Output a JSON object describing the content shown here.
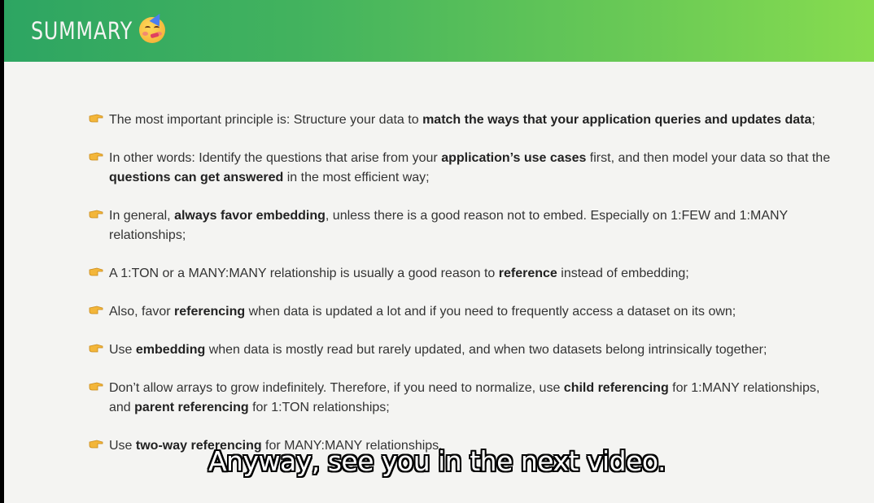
{
  "header": {
    "title": "SUMMARY",
    "emoji": "partying-face-icon",
    "gradient": [
      "#2da562",
      "#87dc4f"
    ]
  },
  "bullet_icon": "pointing-hand-icon",
  "items": [
    {
      "parts": [
        {
          "t": "The most important principle is: Structure your data to ",
          "b": false
        },
        {
          "t": "match the ways that your application queries and updates data",
          "b": true
        },
        {
          "t": ";",
          "b": false
        }
      ]
    },
    {
      "parts": [
        {
          "t": "In other words: Identify the questions that arise from your ",
          "b": false
        },
        {
          "t": "application’s use cases",
          "b": true
        },
        {
          "t": " first, and then model your data so that the ",
          "b": false
        },
        {
          "t": "questions can get answered",
          "b": true
        },
        {
          "t": " in the most efficient way;",
          "b": false
        }
      ]
    },
    {
      "parts": [
        {
          "t": "In general, ",
          "b": false
        },
        {
          "t": "always favor embedding",
          "b": true
        },
        {
          "t": ", unless there is a good reason not to embed. Especially on 1:FEW and 1:MANY relationships;",
          "b": false
        }
      ]
    },
    {
      "parts": [
        {
          "t": "A 1:TON or a MANY:MANY relationship is usually a good reason to ",
          "b": false
        },
        {
          "t": "reference",
          "b": true
        },
        {
          "t": " instead of embedding;",
          "b": false
        }
      ]
    },
    {
      "parts": [
        {
          "t": "Also, favor ",
          "b": false
        },
        {
          "t": "referencing",
          "b": true
        },
        {
          "t": " when data is updated a lot and if you need to frequently access a dataset on its own;",
          "b": false
        }
      ]
    },
    {
      "parts": [
        {
          "t": "Use ",
          "b": false
        },
        {
          "t": "embedding",
          "b": true
        },
        {
          "t": " when data is mostly read but rarely updated, and when two datasets belong intrinsically together;",
          "b": false
        }
      ]
    },
    {
      "parts": [
        {
          "t": "Don’t allow arrays to grow indefinitely. Therefore, if you need to normalize, use ",
          "b": false
        },
        {
          "t": "child referencing",
          "b": true
        },
        {
          "t": " for 1:MANY relationships, and ",
          "b": false
        },
        {
          "t": "parent referencing",
          "b": true
        },
        {
          "t": " for 1:TON relationships;",
          "b": false
        }
      ]
    },
    {
      "parts": [
        {
          "t": "Use ",
          "b": false
        },
        {
          "t": "two-way referencing",
          "b": true
        },
        {
          "t": " for MANY:MANY relationships.",
          "b": false
        }
      ]
    }
  ],
  "subtitle": "Anyway, see you in the next video."
}
